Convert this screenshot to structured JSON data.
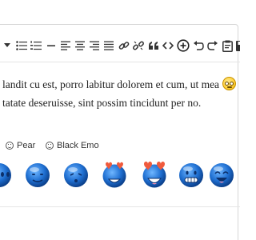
{
  "toolbar": {
    "buttons": [
      {
        "name": "text-color-dropdown",
        "icon": "chevron-down-icon"
      },
      {
        "name": "bullet-list",
        "icon": "bullet-list-icon"
      },
      {
        "name": "numbered-list",
        "icon": "numbered-list-icon"
      },
      {
        "name": "horizontal-line",
        "icon": "horizontal-line-icon"
      },
      {
        "name": "align-left",
        "icon": "align-left-icon"
      },
      {
        "name": "align-center",
        "icon": "align-center-icon"
      },
      {
        "name": "align-right",
        "icon": "align-right-icon"
      },
      {
        "name": "align-justify",
        "icon": "align-justify-icon"
      },
      {
        "name": "insert-link",
        "icon": "link-icon"
      },
      {
        "name": "remove-link",
        "icon": "unlink-icon"
      },
      {
        "name": "blockquote",
        "icon": "quote-icon"
      },
      {
        "name": "source-code",
        "icon": "code-icon"
      },
      {
        "name": "insert",
        "icon": "plus-circle-icon"
      },
      {
        "name": "undo",
        "icon": "undo-icon"
      },
      {
        "name": "redo",
        "icon": "redo-icon"
      },
      {
        "name": "paste",
        "icon": "clipboard-icon"
      },
      {
        "name": "save",
        "icon": "save-icon"
      }
    ]
  },
  "editor": {
    "line1": "landit cu est, porro labitur dolorem et cum, ut mea",
    "line2": "tatate deseruisse, sint possim tincidunt per no."
  },
  "emoji_tabs": {
    "pear": "Pear",
    "black_emo": "Black Emo"
  },
  "emoji_set": {
    "name": "Black Emo",
    "items": [
      "blue-emoji-1",
      "blue-emoji-2",
      "blue-emoji-3",
      "blue-emoji-heart-eyes",
      "blue-emoji-heart-eyes-laugh",
      "blue-emoji-grin",
      "blue-emoji-laugh",
      "blue-emoji-partial"
    ]
  },
  "colors": {
    "emoji_blue": "#1565c0",
    "emoji_blue_light": "#4fa0f2",
    "heart_red": "#f05a3c",
    "toolbar_icon": "#333333",
    "border": "#d6d6d6"
  }
}
